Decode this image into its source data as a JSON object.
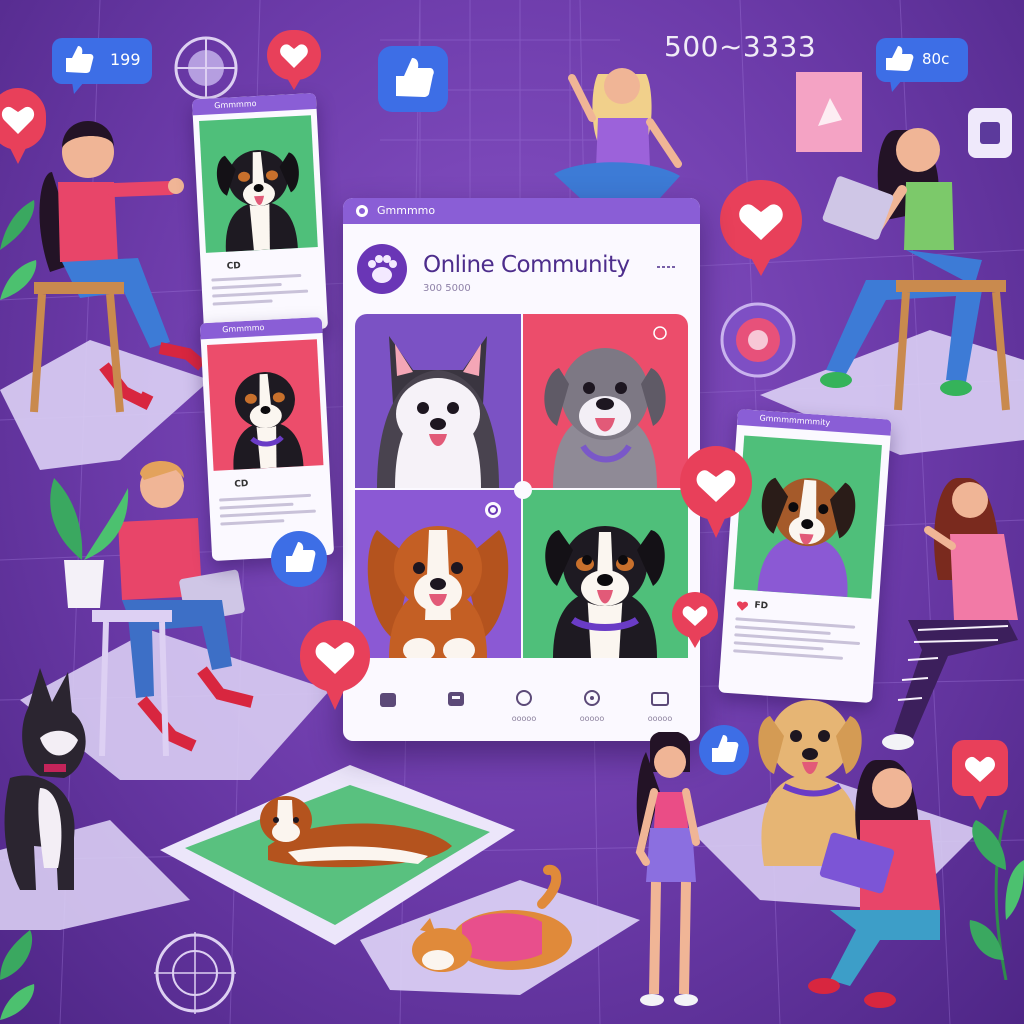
{
  "counter_text": "500~3333",
  "main_card": {
    "topbar_label": "Gmmmmo",
    "title": "Online Community",
    "subtitle": "300 5000",
    "avatar_icon": "paw-icon",
    "tiles": [
      {
        "dog": "husky-puppy",
        "bg": "#7b52c4"
      },
      {
        "dog": "grey-labrador",
        "bg": "#ec4d6b"
      },
      {
        "dog": "cavalier-spaniel",
        "bg": "#8b59d4"
      },
      {
        "dog": "bernese-puppy",
        "bg": "#4fbf7a"
      }
    ],
    "nav": [
      {
        "icon": "home-icon",
        "label": ""
      },
      {
        "icon": "chat-icon",
        "label": ""
      },
      {
        "icon": "search-icon",
        "label": "ooooo"
      },
      {
        "icon": "notifications-icon",
        "label": "ooooo"
      },
      {
        "icon": "profile-icon",
        "label": "ooooo"
      }
    ]
  },
  "side_posts": [
    {
      "header": "Gmmmmo",
      "meta": "CD",
      "dog": "bernese",
      "bg": "#4fbf7a"
    },
    {
      "header": "Gmmmmo",
      "meta": "CD",
      "dog": "bernese",
      "bg": "#ec4d6b"
    },
    {
      "header": "Gmmmmmmmity",
      "meta": "FD",
      "dog": "terrier-mix",
      "bg": "#4fbf7a"
    }
  ],
  "floating": {
    "like_top_left_count": "199",
    "like_top_right_count": "80c",
    "icons": [
      "thumbs-up-icon",
      "heart-icon",
      "target-icon"
    ]
  },
  "colors": {
    "background": "#6b3aa8",
    "accent": "#8a5ed6",
    "heart": "#e8405a",
    "like": "#3d6ee6"
  }
}
